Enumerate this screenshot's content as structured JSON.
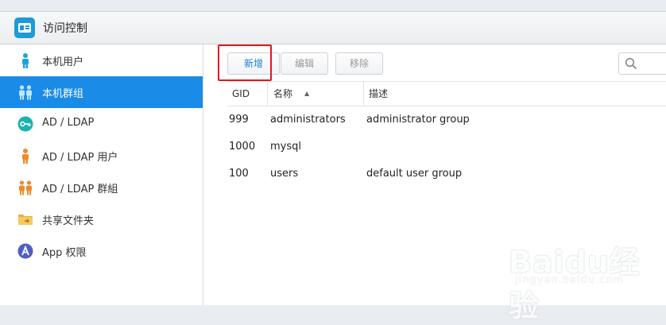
{
  "window": {
    "title": "访问控制",
    "app_icon": "id-card-icon",
    "accent": "#1a8be6"
  },
  "sidebar": {
    "items": [
      {
        "label": "本机用户",
        "icon": "user-icon",
        "active": false
      },
      {
        "label": "本机群组",
        "icon": "group-icon",
        "active": true
      },
      {
        "label": "AD / LDAP",
        "icon": "key-icon",
        "active": false
      },
      {
        "label": "AD / LDAP 用户",
        "icon": "user-orange-icon",
        "active": false
      },
      {
        "label": "AD / LDAP 群組",
        "icon": "group-orange-icon",
        "active": false
      },
      {
        "label": "共享文件夹",
        "icon": "folder-icon",
        "active": false
      },
      {
        "label": "App 权限",
        "icon": "app-icon",
        "active": false
      }
    ]
  },
  "toolbar": {
    "add_label": "新增",
    "edit_label": "编辑",
    "remove_label": "移除",
    "search_placeholder": ""
  },
  "table": {
    "columns": [
      "GID",
      "名称",
      "描述"
    ],
    "sort": {
      "column": "名称",
      "direction": "asc"
    },
    "rows": [
      {
        "gid": "999",
        "name": "administrators",
        "description": "administrator group"
      },
      {
        "gid": "1000",
        "name": "mysql",
        "description": ""
      },
      {
        "gid": "100",
        "name": "users",
        "description": "default user group"
      }
    ]
  },
  "watermark": {
    "main": "Baidu经验",
    "sub": "jingyan.baidu.com"
  }
}
